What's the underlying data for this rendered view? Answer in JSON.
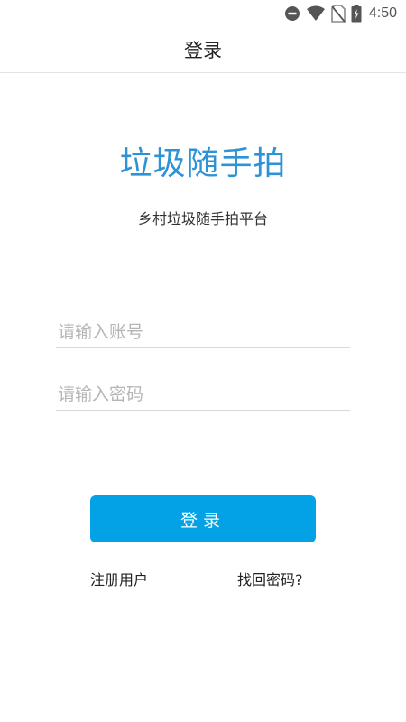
{
  "status_bar": {
    "time": "4:50",
    "icons": [
      "do-not-disturb-icon",
      "wifi-icon",
      "no-sim-icon",
      "battery-charging-icon"
    ]
  },
  "header": {
    "title": "登录"
  },
  "app": {
    "name": "垃圾随手拍",
    "subtitle": "乡村垃圾随手拍平台"
  },
  "form": {
    "account_placeholder": "请输入账号",
    "account_value": "",
    "password_placeholder": "请输入密码",
    "password_value": "",
    "login_label": "登录"
  },
  "links": {
    "register": "注册用户",
    "forgot_password": "找回密码?"
  },
  "colors": {
    "accent": "#03a2e6",
    "app_name": "#2d93d6"
  }
}
